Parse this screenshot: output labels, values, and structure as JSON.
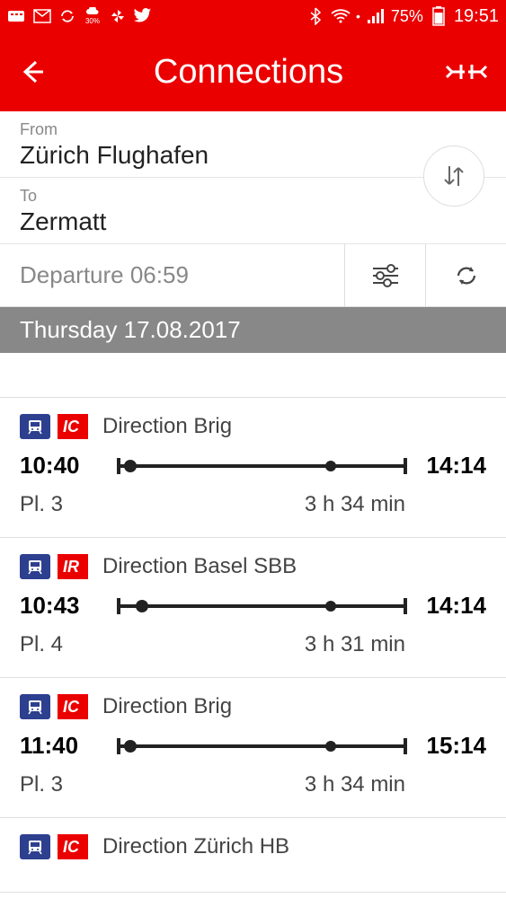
{
  "statusbar": {
    "battery": "75%",
    "time": "19:51"
  },
  "header": {
    "title": "Connections"
  },
  "search": {
    "from_label": "From",
    "from_value": "Zürich Flughafen",
    "to_label": "To",
    "to_value": "Zermatt"
  },
  "controls": {
    "departure": "Departure 06:59"
  },
  "date_header": "Thursday 17.08.2017",
  "connections": [
    {
      "type": "IC",
      "direction": "Direction Brig",
      "dep": "10:40",
      "arr": "14:14",
      "platform": "Pl. 3",
      "duration": "3 h 34 min",
      "dot1": "2%"
    },
    {
      "type": "IR",
      "direction": "Direction Basel SBB",
      "dep": "10:43",
      "arr": "14:14",
      "platform": "Pl. 4",
      "duration": "3 h 31 min",
      "dot1": "6%"
    },
    {
      "type": "IC",
      "direction": "Direction Brig",
      "dep": "11:40",
      "arr": "15:14",
      "platform": "Pl. 3",
      "duration": "3 h 34 min",
      "dot1": "2%"
    },
    {
      "type": "IC",
      "direction": "Direction Zürich HB",
      "dep": "",
      "arr": "",
      "platform": "",
      "duration": "",
      "dot1": "2%"
    }
  ]
}
